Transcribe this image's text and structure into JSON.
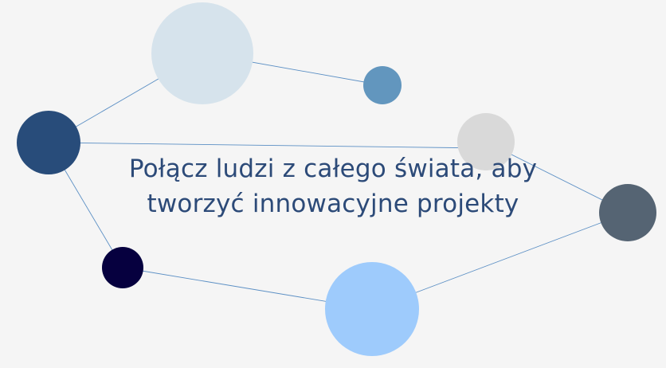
{
  "headline": {
    "line1": "Połącz ludzi z całego świata, aby",
    "line2": "tworzyć innowacyjne projekty"
  },
  "colors": {
    "background": "#f5f5f5",
    "text": "#2c4a78",
    "line": "#5b8fc4",
    "node_pale_blue": "#d6e3ec",
    "node_steel_blue": "#6296be",
    "node_navy": "#284c7a",
    "node_light_gray": "#d9d9d9",
    "node_slate": "#556473",
    "node_dark_indigo": "#06003f",
    "node_sky_blue": "#9ecbfc"
  }
}
